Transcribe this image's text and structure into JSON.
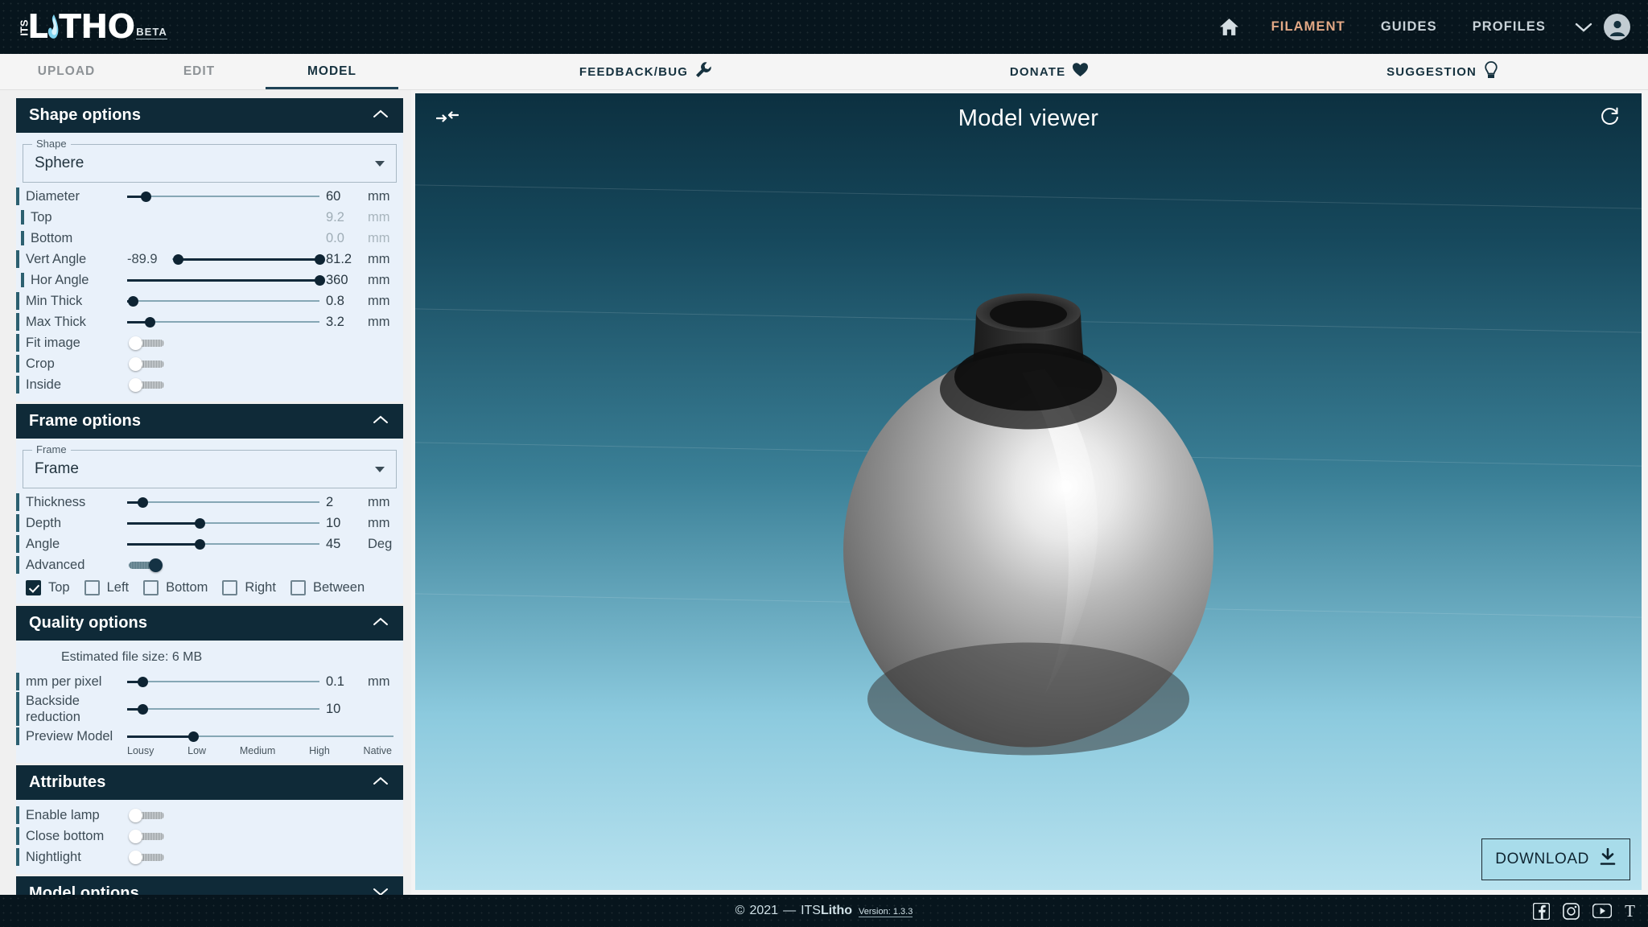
{
  "header": {
    "logo": {
      "prefix": "ITS",
      "main_a": "L",
      "main_b": "THO",
      "badge": "BETA",
      "flame_icon": "flame-icon"
    },
    "nav": [
      {
        "label": "FILAMENT",
        "accent": true
      },
      {
        "label": "GUIDES",
        "accent": false
      },
      {
        "label": "PROFILES",
        "accent": false
      }
    ],
    "home_icon": "home-icon",
    "chevron_icon": "chevron-down-icon",
    "avatar_icon": "account-avatar-icon",
    "accent_color": "#e2a885",
    "bg_color": "#07151d"
  },
  "tabs": [
    {
      "label": "UPLOAD",
      "active": false
    },
    {
      "label": "EDIT",
      "active": false
    },
    {
      "label": "MODEL",
      "active": true
    }
  ],
  "quicklinks": [
    {
      "label": "FEEDBACK/BUG",
      "icon": "wrench-icon"
    },
    {
      "label": "DONATE",
      "icon": "heart-icon"
    },
    {
      "label": "SUGGESTION",
      "icon": "lightbulb-icon"
    }
  ],
  "panels": {
    "shape": {
      "title": "Shape options",
      "collapse_icon": "chevron-up-icon",
      "select": {
        "legend": "Shape",
        "value": "Sphere"
      },
      "rows": [
        {
          "label": "Diameter",
          "type": "slider",
          "value": "60",
          "unit": "mm",
          "pct": 10,
          "sub": false,
          "muted": false
        },
        {
          "label": "Top",
          "type": "value",
          "value": "9.2",
          "unit": "mm",
          "sub": true,
          "muted": true
        },
        {
          "label": "Bottom",
          "type": "value",
          "value": "0.0",
          "unit": "mm",
          "sub": true,
          "muted": true
        },
        {
          "label": "Vert Angle",
          "type": "range",
          "prefix": "-89.9",
          "value": "81.2",
          "unit": "mm",
          "pct_low": 20,
          "pct_high": 100,
          "sub": false,
          "muted": false
        },
        {
          "label": "Hor Angle",
          "type": "slider",
          "value": "360",
          "unit": "mm",
          "pct": 100,
          "sub": true,
          "muted": false
        },
        {
          "label": "Min Thick",
          "type": "slider",
          "value": "0.8",
          "unit": "mm",
          "pct": 3,
          "sub": false,
          "muted": false
        },
        {
          "label": "Max Thick",
          "type": "slider",
          "value": "3.2",
          "unit": "mm",
          "pct": 12,
          "sub": false,
          "muted": false
        },
        {
          "label": "Fit image",
          "type": "toggle",
          "on": false,
          "sub": false
        },
        {
          "label": "Crop",
          "type": "toggle",
          "on": false,
          "sub": false
        },
        {
          "label": "Inside",
          "type": "toggle",
          "on": false,
          "sub": false
        }
      ]
    },
    "frame": {
      "title": "Frame options",
      "collapse_icon": "chevron-up-icon",
      "select": {
        "legend": "Frame",
        "value": "Frame"
      },
      "rows": [
        {
          "label": "Thickness",
          "type": "slider",
          "value": "2",
          "unit": "mm",
          "pct": 8,
          "sub": false
        },
        {
          "label": "Depth",
          "type": "slider",
          "value": "10",
          "unit": "mm",
          "pct": 38,
          "sub": false
        },
        {
          "label": "Angle",
          "type": "slider",
          "value": "45",
          "unit": "Deg",
          "pct": 38,
          "sub": false
        },
        {
          "label": "Advanced",
          "type": "toggle",
          "on": true,
          "sub": false
        }
      ],
      "checkboxes": [
        {
          "label": "Top",
          "checked": true
        },
        {
          "label": "Left",
          "checked": false
        },
        {
          "label": "Bottom",
          "checked": false
        },
        {
          "label": "Right",
          "checked": false
        },
        {
          "label": "Between",
          "checked": false
        }
      ]
    },
    "quality": {
      "title": "Quality options",
      "collapse_icon": "chevron-up-icon",
      "estimated_size": "Estimated file size: 6 MB",
      "rows": [
        {
          "label": "mm per pixel",
          "type": "slider",
          "value": "0.1",
          "unit": "mm",
          "pct": 8,
          "sub": false
        },
        {
          "label": "Backside reduction",
          "type": "slider",
          "value": "10",
          "unit": "",
          "pct": 8,
          "sub": false
        }
      ],
      "preview": {
        "label": "Preview Model",
        "value_pct": 25,
        "ticks": [
          "Lousy",
          "Low",
          "Medium",
          "High",
          "Native"
        ]
      }
    },
    "attributes": {
      "title": "Attributes",
      "collapse_icon": "chevron-up-icon",
      "rows": [
        {
          "label": "Enable lamp",
          "type": "toggle",
          "on": false
        },
        {
          "label": "Close bottom",
          "type": "toggle",
          "on": false
        },
        {
          "label": "Nightlight",
          "type": "toggle",
          "on": false
        }
      ]
    },
    "model": {
      "title": "Model options",
      "collapse_icon": "chevron-down-icon"
    }
  },
  "viewer": {
    "title": "Model viewer",
    "collapse_icon": "collapse-horizontal-icon",
    "refresh_icon": "refresh-icon",
    "download": {
      "label": "DOWNLOAD",
      "icon": "download-icon"
    },
    "model_shape": "sphere-with-neck"
  },
  "footer": {
    "copyright_symbol": "©",
    "year": "2021",
    "dash": "—",
    "brand_a": "ITS",
    "brand_b": "Litho",
    "version": "Version: 1.3.3",
    "social": [
      {
        "name": "facebook-icon"
      },
      {
        "name": "instagram-icon"
      },
      {
        "name": "youtube-icon"
      },
      {
        "name": "thingiverse-icon",
        "glyph": "T"
      }
    ]
  }
}
